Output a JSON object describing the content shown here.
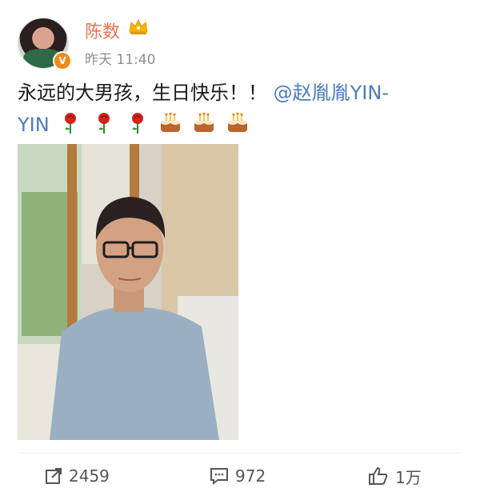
{
  "post": {
    "username": "陈数",
    "timestamp": "昨天 11:40",
    "verified_badge": "V",
    "text_main": "永远的大男孩，生日快乐！！",
    "mention_line1": "@赵胤胤YIN-",
    "mention_line2": "YIN",
    "emojis": [
      "rose-icon",
      "rose-icon",
      "rose-icon",
      "birthday-cake-icon",
      "birthday-cake-icon",
      "birthday-cake-icon"
    ],
    "image_alt": "photo-of-man-in-grey-tshirt"
  },
  "actions": {
    "repost_count": "2459",
    "comment_count": "972",
    "like_count": "1万"
  },
  "colors": {
    "username": "#eb7350",
    "mention": "#4a7cbd",
    "verified_badge": "#f08c1a"
  }
}
